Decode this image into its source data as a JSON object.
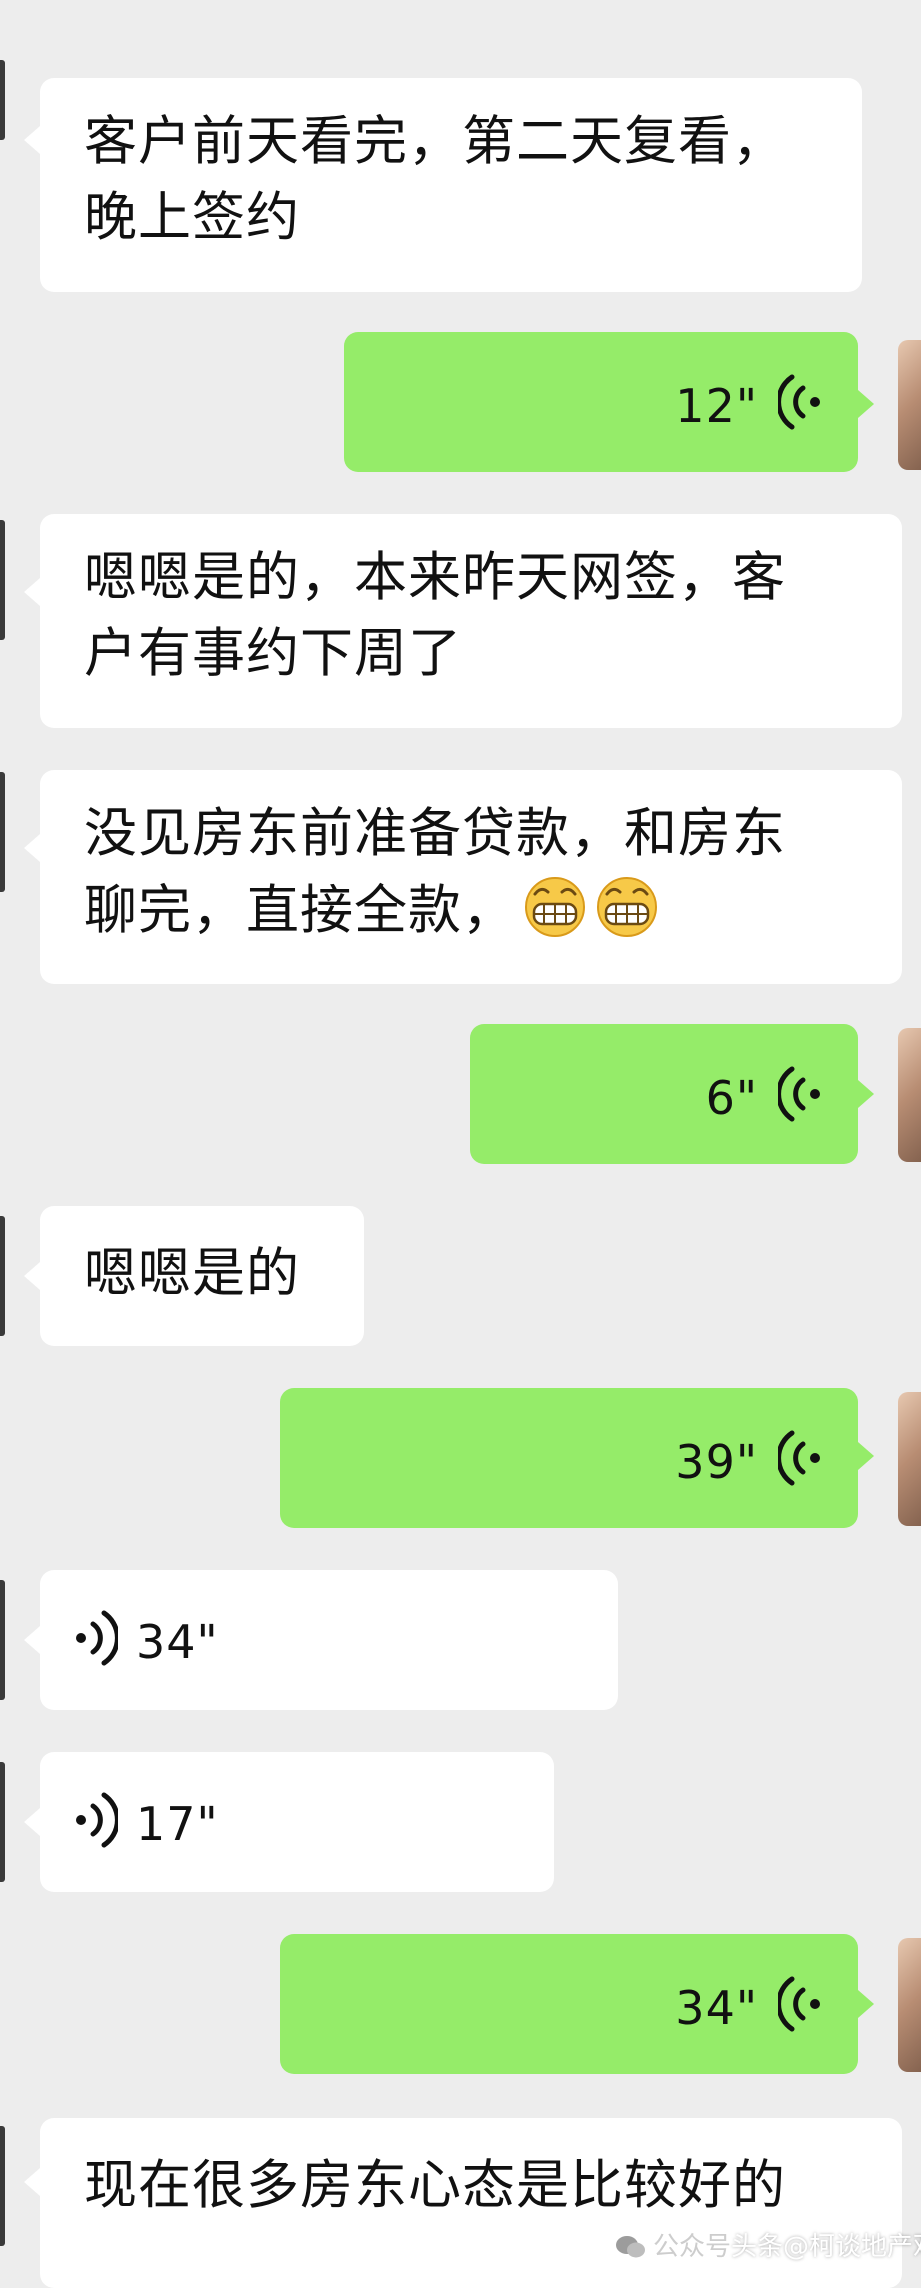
{
  "chat": {
    "messages": [
      {
        "side": "left",
        "type": "text",
        "lines": [
          "客户前天看完，第二天复看，",
          "晚上签约"
        ]
      },
      {
        "side": "right",
        "type": "voice",
        "duration": "12\""
      },
      {
        "side": "left",
        "type": "text",
        "lines": [
          "嗯嗯是的，本来昨天网签，客",
          "户有事约下周了"
        ]
      },
      {
        "side": "left",
        "type": "text",
        "lines": [
          "没见房东前准备贷款，和房东",
          "聊完，直接全款，"
        ],
        "emoji": [
          "grinning-face-emoji",
          "grinning-face-emoji"
        ]
      },
      {
        "side": "right",
        "type": "voice",
        "duration": "6\""
      },
      {
        "side": "left",
        "type": "text",
        "lines": [
          "嗯嗯是的"
        ]
      },
      {
        "side": "right",
        "type": "voice",
        "duration": "39\""
      },
      {
        "side": "left",
        "type": "voice",
        "duration": "34\""
      },
      {
        "side": "left",
        "type": "voice",
        "duration": "17\""
      },
      {
        "side": "right",
        "type": "voice",
        "duration": "34\""
      },
      {
        "side": "left",
        "type": "text",
        "lines": [
          "现在很多房东心态是比较好的"
        ]
      }
    ]
  },
  "watermark": {
    "prefix": "公众号",
    "source": "头条",
    "handle": "@柯谈地产观",
    "icon": "wechat-icon"
  },
  "colors": {
    "background": "#ededed",
    "incoming_bubble": "#ffffff",
    "outgoing_bubble": "#95ec69"
  }
}
